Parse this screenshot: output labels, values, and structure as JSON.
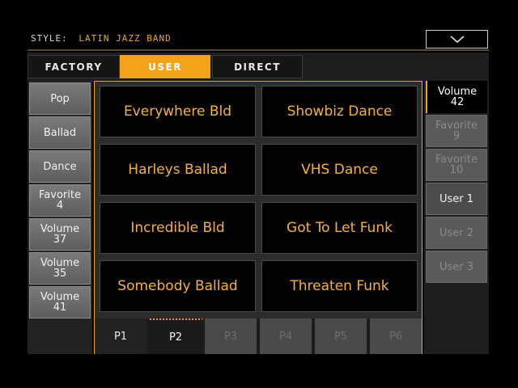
{
  "header": {
    "style_key": "STYLE:",
    "style_value": "LATIN JAZZ BAND"
  },
  "colors": {
    "accent": "#f5a21b",
    "button_text": "#f5b040"
  },
  "tabs": [
    {
      "label": "FACTORY",
      "selected": false
    },
    {
      "label": "USER",
      "selected": true
    },
    {
      "label": "DIRECT",
      "selected": false
    }
  ],
  "left_buttons": [
    {
      "label": "Pop"
    },
    {
      "label": "Ballad"
    },
    {
      "label": "Dance"
    },
    {
      "label": "Favorite",
      "sub": "4"
    },
    {
      "label": "Volume",
      "sub": "37"
    },
    {
      "label": "Volume",
      "sub": "35"
    },
    {
      "label": "Volume",
      "sub": "41"
    }
  ],
  "grid": [
    "Everywhere Bld",
    "Showbiz Dance",
    "Harleys Ballad",
    "VHS Dance",
    "Incredible Bld",
    "Got To Let Funk",
    "Somebody Ballad",
    "Threaten Funk"
  ],
  "pages": [
    "P1",
    "P2",
    "P3",
    "P4",
    "P5",
    "P6"
  ],
  "selected_page": "P2",
  "right_buttons": [
    {
      "label": "Volume",
      "sub": "42"
    },
    {
      "label": "Favorite",
      "sub": "9"
    },
    {
      "label": "Favorite",
      "sub": "10"
    },
    {
      "label": "User 1"
    },
    {
      "label": "User 2"
    },
    {
      "label": "User 3"
    }
  ]
}
